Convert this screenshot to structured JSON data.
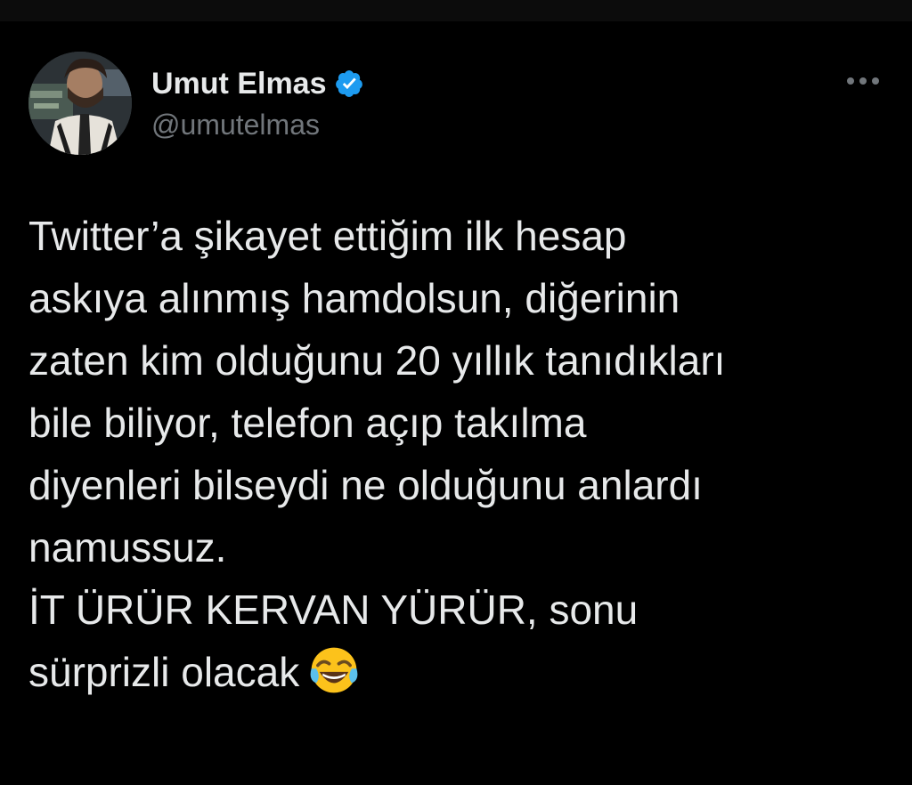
{
  "author": {
    "name": "Umut Elmas",
    "handle": "@umutelmas",
    "verified": true
  },
  "tweet": {
    "lines": [
      "Twitter’a şikayet ettiğim ilk hesap",
      "askıya alınmış hamdolsun, diğerinin",
      "zaten kim olduğunu 20 yıllık tanıdıkları",
      "bile biliyor, telefon açıp takılma",
      "diyenleri bilseydi ne olduğunu anlardı",
      "namussuz.",
      "İT ÜRÜR KERVAN YÜRÜR, sonu",
      "sürprizli olacak"
    ],
    "emoji": "face-with-tears-of-joy-icon"
  },
  "colors": {
    "background": "#000000",
    "text": "#e7e9ea",
    "secondary_text": "#71767b",
    "verified_blue": "#1d9bf0"
  }
}
